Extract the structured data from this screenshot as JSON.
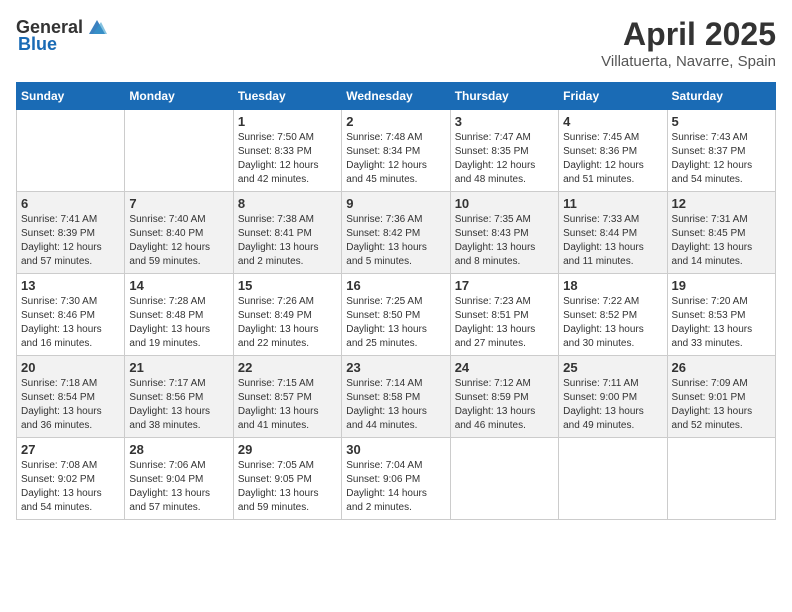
{
  "header": {
    "logo_general": "General",
    "logo_blue": "Blue",
    "month_title": "April 2025",
    "location": "Villatuerta, Navarre, Spain"
  },
  "weekdays": [
    "Sunday",
    "Monday",
    "Tuesday",
    "Wednesday",
    "Thursday",
    "Friday",
    "Saturday"
  ],
  "weeks": [
    [
      {
        "day": "",
        "sunrise": "",
        "sunset": "",
        "daylight": ""
      },
      {
        "day": "",
        "sunrise": "",
        "sunset": "",
        "daylight": ""
      },
      {
        "day": "1",
        "sunrise": "Sunrise: 7:50 AM",
        "sunset": "Sunset: 8:33 PM",
        "daylight": "Daylight: 12 hours and 42 minutes."
      },
      {
        "day": "2",
        "sunrise": "Sunrise: 7:48 AM",
        "sunset": "Sunset: 8:34 PM",
        "daylight": "Daylight: 12 hours and 45 minutes."
      },
      {
        "day": "3",
        "sunrise": "Sunrise: 7:47 AM",
        "sunset": "Sunset: 8:35 PM",
        "daylight": "Daylight: 12 hours and 48 minutes."
      },
      {
        "day": "4",
        "sunrise": "Sunrise: 7:45 AM",
        "sunset": "Sunset: 8:36 PM",
        "daylight": "Daylight: 12 hours and 51 minutes."
      },
      {
        "day": "5",
        "sunrise": "Sunrise: 7:43 AM",
        "sunset": "Sunset: 8:37 PM",
        "daylight": "Daylight: 12 hours and 54 minutes."
      }
    ],
    [
      {
        "day": "6",
        "sunrise": "Sunrise: 7:41 AM",
        "sunset": "Sunset: 8:39 PM",
        "daylight": "Daylight: 12 hours and 57 minutes."
      },
      {
        "day": "7",
        "sunrise": "Sunrise: 7:40 AM",
        "sunset": "Sunset: 8:40 PM",
        "daylight": "Daylight: 12 hours and 59 minutes."
      },
      {
        "day": "8",
        "sunrise": "Sunrise: 7:38 AM",
        "sunset": "Sunset: 8:41 PM",
        "daylight": "Daylight: 13 hours and 2 minutes."
      },
      {
        "day": "9",
        "sunrise": "Sunrise: 7:36 AM",
        "sunset": "Sunset: 8:42 PM",
        "daylight": "Daylight: 13 hours and 5 minutes."
      },
      {
        "day": "10",
        "sunrise": "Sunrise: 7:35 AM",
        "sunset": "Sunset: 8:43 PM",
        "daylight": "Daylight: 13 hours and 8 minutes."
      },
      {
        "day": "11",
        "sunrise": "Sunrise: 7:33 AM",
        "sunset": "Sunset: 8:44 PM",
        "daylight": "Daylight: 13 hours and 11 minutes."
      },
      {
        "day": "12",
        "sunrise": "Sunrise: 7:31 AM",
        "sunset": "Sunset: 8:45 PM",
        "daylight": "Daylight: 13 hours and 14 minutes."
      }
    ],
    [
      {
        "day": "13",
        "sunrise": "Sunrise: 7:30 AM",
        "sunset": "Sunset: 8:46 PM",
        "daylight": "Daylight: 13 hours and 16 minutes."
      },
      {
        "day": "14",
        "sunrise": "Sunrise: 7:28 AM",
        "sunset": "Sunset: 8:48 PM",
        "daylight": "Daylight: 13 hours and 19 minutes."
      },
      {
        "day": "15",
        "sunrise": "Sunrise: 7:26 AM",
        "sunset": "Sunset: 8:49 PM",
        "daylight": "Daylight: 13 hours and 22 minutes."
      },
      {
        "day": "16",
        "sunrise": "Sunrise: 7:25 AM",
        "sunset": "Sunset: 8:50 PM",
        "daylight": "Daylight: 13 hours and 25 minutes."
      },
      {
        "day": "17",
        "sunrise": "Sunrise: 7:23 AM",
        "sunset": "Sunset: 8:51 PM",
        "daylight": "Daylight: 13 hours and 27 minutes."
      },
      {
        "day": "18",
        "sunrise": "Sunrise: 7:22 AM",
        "sunset": "Sunset: 8:52 PM",
        "daylight": "Daylight: 13 hours and 30 minutes."
      },
      {
        "day": "19",
        "sunrise": "Sunrise: 7:20 AM",
        "sunset": "Sunset: 8:53 PM",
        "daylight": "Daylight: 13 hours and 33 minutes."
      }
    ],
    [
      {
        "day": "20",
        "sunrise": "Sunrise: 7:18 AM",
        "sunset": "Sunset: 8:54 PM",
        "daylight": "Daylight: 13 hours and 36 minutes."
      },
      {
        "day": "21",
        "sunrise": "Sunrise: 7:17 AM",
        "sunset": "Sunset: 8:56 PM",
        "daylight": "Daylight: 13 hours and 38 minutes."
      },
      {
        "day": "22",
        "sunrise": "Sunrise: 7:15 AM",
        "sunset": "Sunset: 8:57 PM",
        "daylight": "Daylight: 13 hours and 41 minutes."
      },
      {
        "day": "23",
        "sunrise": "Sunrise: 7:14 AM",
        "sunset": "Sunset: 8:58 PM",
        "daylight": "Daylight: 13 hours and 44 minutes."
      },
      {
        "day": "24",
        "sunrise": "Sunrise: 7:12 AM",
        "sunset": "Sunset: 8:59 PM",
        "daylight": "Daylight: 13 hours and 46 minutes."
      },
      {
        "day": "25",
        "sunrise": "Sunrise: 7:11 AM",
        "sunset": "Sunset: 9:00 PM",
        "daylight": "Daylight: 13 hours and 49 minutes."
      },
      {
        "day": "26",
        "sunrise": "Sunrise: 7:09 AM",
        "sunset": "Sunset: 9:01 PM",
        "daylight": "Daylight: 13 hours and 52 minutes."
      }
    ],
    [
      {
        "day": "27",
        "sunrise": "Sunrise: 7:08 AM",
        "sunset": "Sunset: 9:02 PM",
        "daylight": "Daylight: 13 hours and 54 minutes."
      },
      {
        "day": "28",
        "sunrise": "Sunrise: 7:06 AM",
        "sunset": "Sunset: 9:04 PM",
        "daylight": "Daylight: 13 hours and 57 minutes."
      },
      {
        "day": "29",
        "sunrise": "Sunrise: 7:05 AM",
        "sunset": "Sunset: 9:05 PM",
        "daylight": "Daylight: 13 hours and 59 minutes."
      },
      {
        "day": "30",
        "sunrise": "Sunrise: 7:04 AM",
        "sunset": "Sunset: 9:06 PM",
        "daylight": "Daylight: 14 hours and 2 minutes."
      },
      {
        "day": "",
        "sunrise": "",
        "sunset": "",
        "daylight": ""
      },
      {
        "day": "",
        "sunrise": "",
        "sunset": "",
        "daylight": ""
      },
      {
        "day": "",
        "sunrise": "",
        "sunset": "",
        "daylight": ""
      }
    ]
  ]
}
